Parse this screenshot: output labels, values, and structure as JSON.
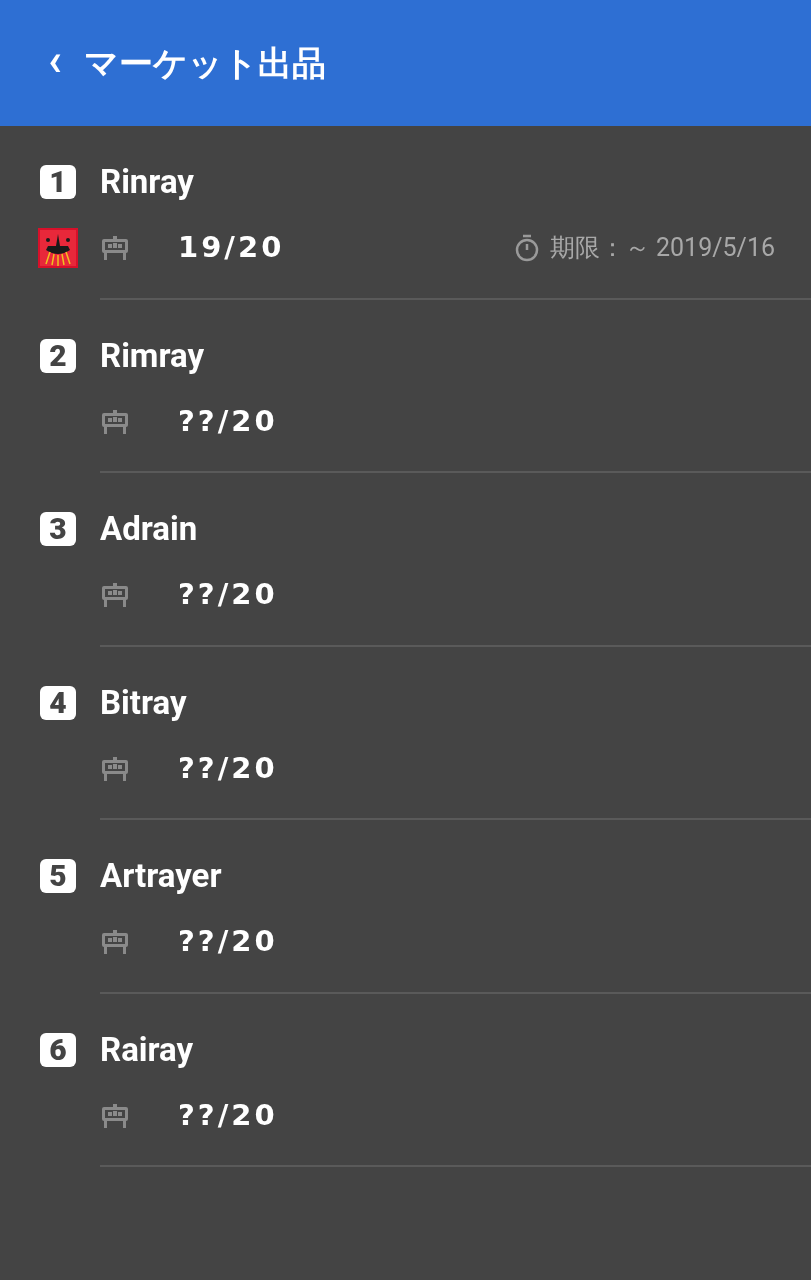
{
  "header": {
    "back_icon": "‹",
    "title": "マーケット出品"
  },
  "items": [
    {
      "rank": "1",
      "name": "Rinray",
      "count": "19/20",
      "deadline": "期限：～ 2019/5/16"
    },
    {
      "rank": "2",
      "name": "Rimray",
      "count": "??/20"
    },
    {
      "rank": "3",
      "name": "Adrain",
      "count": "??/20"
    },
    {
      "rank": "4",
      "name": "Bitray",
      "count": "??/20"
    },
    {
      "rank": "5",
      "name": "Artrayer",
      "count": "??/20"
    },
    {
      "rank": "6",
      "name": "Rairay",
      "count": "??/20"
    }
  ]
}
